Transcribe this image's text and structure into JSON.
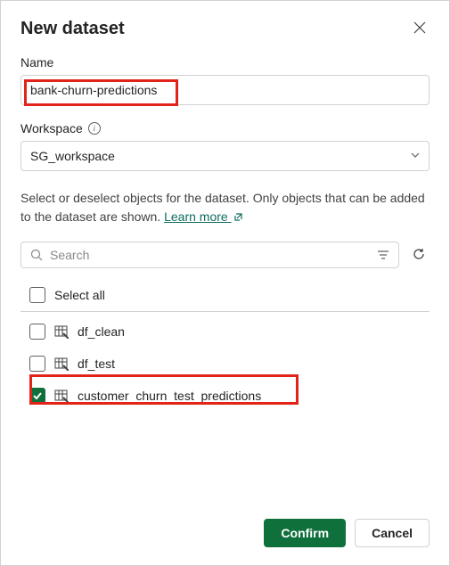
{
  "dialog": {
    "title": "New dataset",
    "name_label": "Name",
    "name_value": "bank-churn-predictions",
    "workspace_label": "Workspace",
    "workspace_value": "SG_workspace",
    "helper_text_a": "Select or deselect objects for the dataset. Only objects that can be added to the dataset are shown. ",
    "learn_more": "Learn more ",
    "search_placeholder": "Search",
    "select_all": "Select all",
    "items": [
      {
        "label": "df_clean",
        "checked": false
      },
      {
        "label": "df_test",
        "checked": false
      },
      {
        "label": "customer_churn_test_predictions",
        "checked": true
      }
    ],
    "confirm": "Confirm",
    "cancel": "Cancel"
  }
}
